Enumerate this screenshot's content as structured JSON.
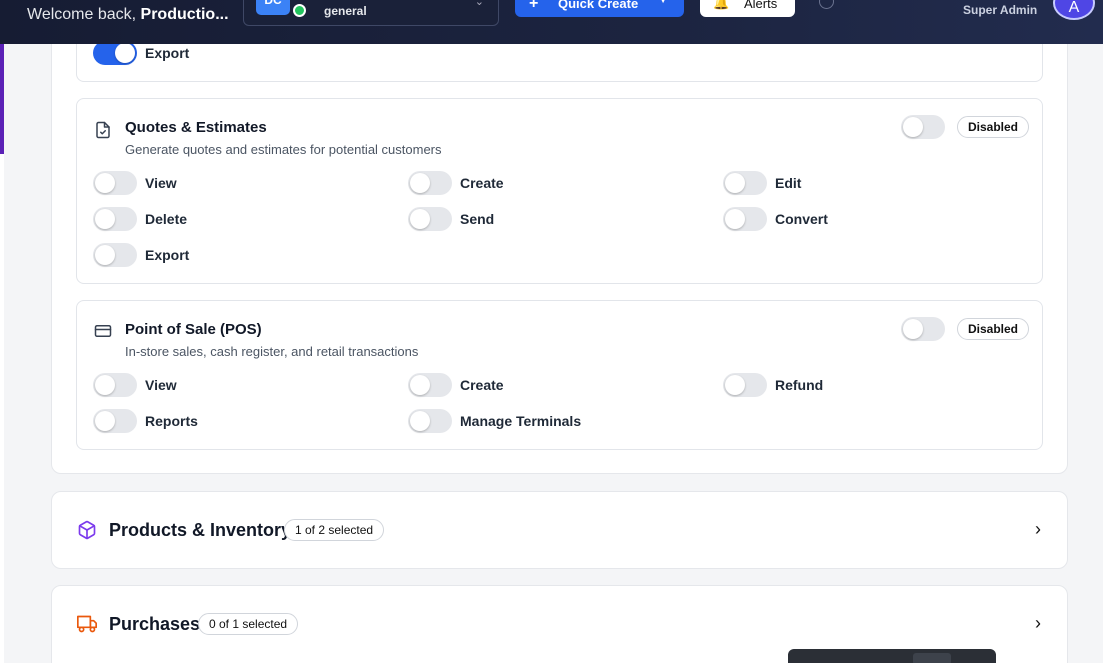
{
  "header": {
    "welcome_prefix": "Welcome back, ",
    "welcome_name": "Productio...",
    "workspace_initials": "DC",
    "workspace_name": "general",
    "quick_create_label": "Quick Create",
    "alerts_label": "Alerts",
    "user_role": "Super Admin",
    "user_initial": "A"
  },
  "modules": {
    "previous": {
      "permissions": [
        {
          "label": "Export",
          "enabled": true
        }
      ]
    },
    "quotes": {
      "title": "Quotes & Estimates",
      "description": "Generate quotes and estimates for potential customers",
      "status": "Disabled",
      "icon": "document-check-icon",
      "permissions": [
        {
          "label": "View",
          "enabled": false
        },
        {
          "label": "Create",
          "enabled": false
        },
        {
          "label": "Edit",
          "enabled": false
        },
        {
          "label": "Delete",
          "enabled": false
        },
        {
          "label": "Send",
          "enabled": false
        },
        {
          "label": "Convert",
          "enabled": false
        },
        {
          "label": "Export",
          "enabled": false
        }
      ]
    },
    "pos": {
      "title": "Point of Sale (POS)",
      "description": "In-store sales, cash register, and retail transactions",
      "status": "Disabled",
      "icon": "credit-card-icon",
      "permissions": [
        {
          "label": "View",
          "enabled": false
        },
        {
          "label": "Create",
          "enabled": false
        },
        {
          "label": "Refund",
          "enabled": false
        },
        {
          "label": "Reports",
          "enabled": false
        },
        {
          "label": "Manage Terminals",
          "enabled": false
        }
      ]
    }
  },
  "categories": [
    {
      "title": "Products & Inventory",
      "badge": "1 of 2 selected",
      "icon": "cube-icon",
      "color": "#7c3aed"
    },
    {
      "title": "Purchases",
      "badge": "0 of 1 selected",
      "icon": "truck-icon",
      "color": "#ea580c"
    }
  ],
  "colors": {
    "accent": "#2563eb",
    "header_bg": "#161c33"
  }
}
